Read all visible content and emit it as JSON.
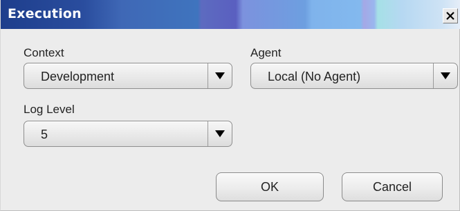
{
  "window": {
    "title": "Execution"
  },
  "fields": {
    "context": {
      "label": "Context",
      "value": "Development"
    },
    "agent": {
      "label": "Agent",
      "value": "Local (No Agent)"
    },
    "log_level": {
      "label": "Log Level",
      "value": "5"
    }
  },
  "buttons": {
    "ok": "OK",
    "cancel": "Cancel"
  },
  "icons": {
    "close": "close-icon",
    "dropdown": "triangle-down-icon"
  },
  "colors": {
    "titlebar_text": "#ffffff",
    "dialog_background": "#ececec"
  }
}
